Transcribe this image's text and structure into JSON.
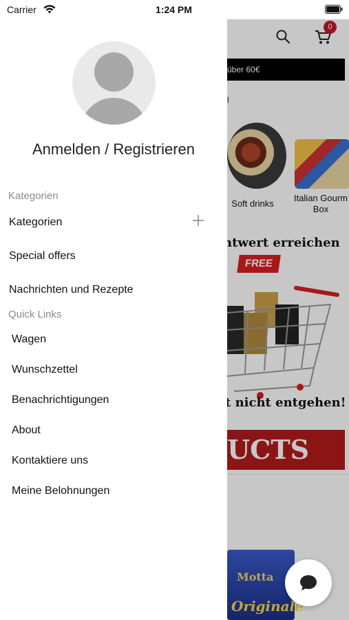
{
  "status_bar": {
    "carrier": "Carrier",
    "time": "1:24 PM"
  },
  "drawer": {
    "avatar_icon": "user-avatar-placeholder",
    "login_label": "Anmelden / Registrieren",
    "categories_section_label": "Kategorien",
    "categories_items": [
      {
        "label": "Kategorien",
        "expandable": true,
        "icon": "plus-icon"
      },
      {
        "label": "Special offers"
      },
      {
        "label": "Nachrichten und Rezepte"
      }
    ],
    "quick_links_label": "Quick Links",
    "quick_links": [
      {
        "label": "Wagen"
      },
      {
        "label": "Wunschzettel"
      },
      {
        "label": "Benachrichtigungen"
      },
      {
        "label": "About"
      },
      {
        "label": "Kontaktiere uns"
      },
      {
        "label": "Meine Belohnungen"
      }
    ]
  },
  "background_app": {
    "cart_badge_count": "0",
    "promo_text": "über 60€",
    "tiny_mark": "l",
    "categories": [
      {
        "label": "Soft drinks"
      },
      {
        "label_line1": "Italian Gourm",
        "label_line2": "Box"
      }
    ],
    "heading_1": "ntwert erreichen",
    "free_tag": "FREE",
    "heading_2": "t nicht entgehen!",
    "products_banner": "UCTS",
    "product_brand": "Motta",
    "product_name": "Originale"
  },
  "colors": {
    "accent_red": "#c2182b",
    "banner_red": "#b31c1c",
    "promo_bar": "#000000",
    "avatar_gray": "#a8a8a8",
    "section_label_gray": "#8a8a8a"
  }
}
